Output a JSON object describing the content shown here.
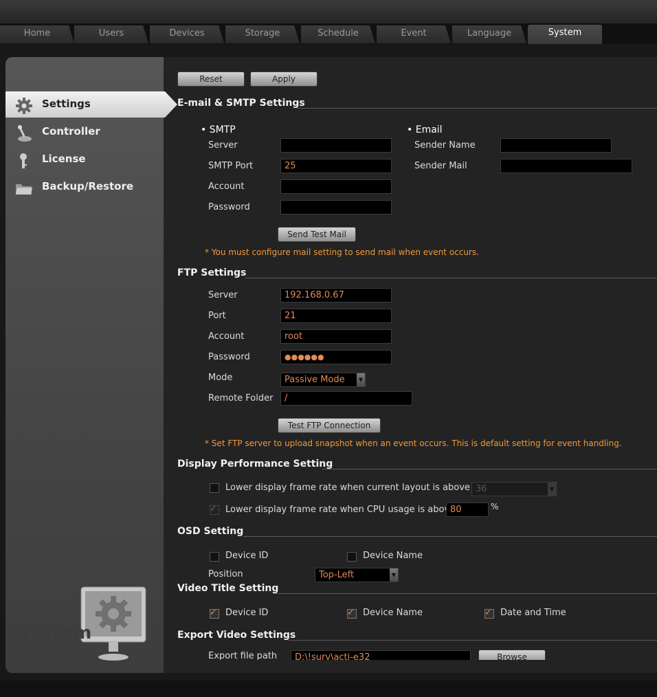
{
  "tabs": [
    {
      "label": "Home"
    },
    {
      "label": "Users"
    },
    {
      "label": "Devices"
    },
    {
      "label": "Storage"
    },
    {
      "label": "Schedule"
    },
    {
      "label": "Event"
    },
    {
      "label": "Language"
    },
    {
      "label": "System"
    }
  ],
  "sidebar": {
    "items": [
      {
        "label": "Settings",
        "icon": "gear-icon"
      },
      {
        "label": "Controller",
        "icon": "joystick-icon"
      },
      {
        "label": "License",
        "icon": "key-icon"
      },
      {
        "label": "Backup/Restore",
        "icon": "folder-icon"
      }
    ],
    "badge_label": "System"
  },
  "toolbar": {
    "reset": "Reset",
    "apply": "Apply"
  },
  "email_section": {
    "title": "E-mail & SMTP Settings",
    "smtp_head": "SMTP",
    "email_head": "Email",
    "server_label": "Server",
    "server_value": "",
    "port_label": "SMTP Port",
    "port_value": "25",
    "account_label": "Account",
    "account_value": "",
    "password_label": "Password",
    "password_value": "",
    "sender_name_label": "Sender Name",
    "sender_name_value": "",
    "sender_mail_label": "Sender Mail",
    "sender_mail_value": "",
    "test_button": "Send Test Mail",
    "note": "* You must configure mail setting to send mail when event occurs."
  },
  "ftp_section": {
    "title": "FTP Settings",
    "server_label": "Server",
    "server_value": "192.168.0.67",
    "port_label": "Port",
    "port_value": "21",
    "account_label": "Account",
    "account_value": "root",
    "password_label": "Password",
    "password_value": "●●●●●●",
    "mode_label": "Mode",
    "mode_value": "Passive Mode",
    "folder_label": "Remote Folder",
    "folder_value": "/",
    "test_button": "Test FTP Connection",
    "note": "* Set FTP server to upload snapshot when an event occurs. This is default setting for event handling."
  },
  "display_section": {
    "title": "Display Performance Setting",
    "layout_label": "Lower display frame rate when current layout is above",
    "layout_value": "36",
    "cpu_label": "Lower display frame rate when CPU usage is above",
    "cpu_value": "80",
    "cpu_unit": "%"
  },
  "osd_section": {
    "title": "OSD Setting",
    "device_id": "Device ID",
    "device_name": "Device Name",
    "position_label": "Position",
    "position_value": "Top-Left"
  },
  "video_title_section": {
    "title": "Video Title Setting",
    "device_id": "Device ID",
    "device_name": "Device Name",
    "date_time": "Date and Time"
  },
  "export_section": {
    "title": "Export Video Settings",
    "path_label": "Export file path",
    "path_value": "D:\\!surv\\acti-e32",
    "browse": "Browse"
  }
}
